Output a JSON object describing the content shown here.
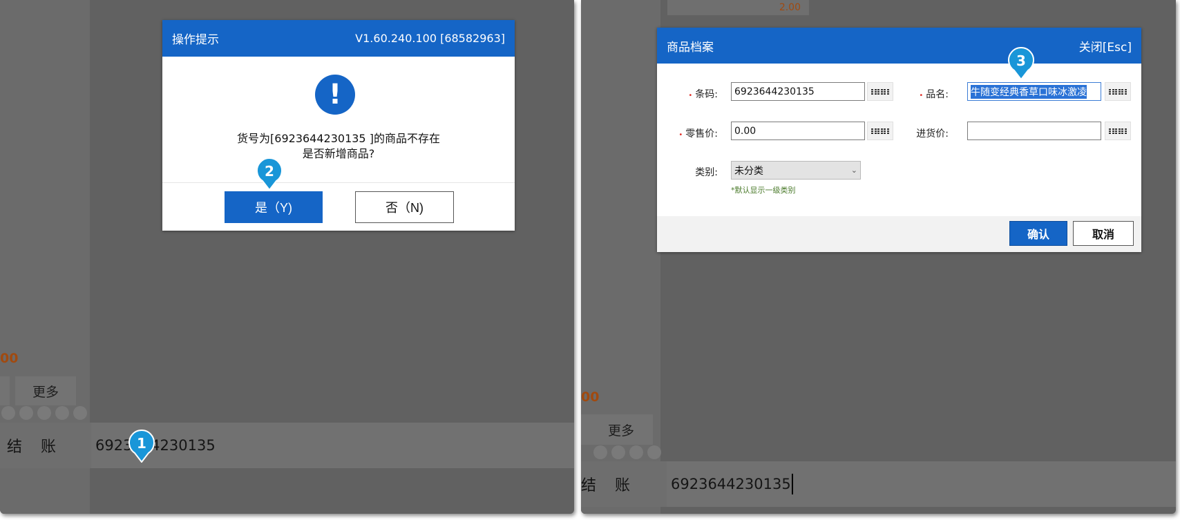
{
  "left_panel": {
    "price_fragment": "00",
    "more_button": "更多",
    "checkout_label": "结 账",
    "scan_value": "6923644230135"
  },
  "confirm_dialog": {
    "title": "操作提示",
    "version": "V1.60.240.100 [68582963]",
    "icon": "exclamation-icon",
    "message_line1": "货号为[6923644230135 ]的商品不存在",
    "message_line2": "是否新增商品?",
    "yes_button": "是（Y)",
    "no_button": "否（N)"
  },
  "right_panel": {
    "top_price": "2.00",
    "price_fragment": "00",
    "more_button": "更多",
    "checkout_label": "结 账",
    "scan_value": "6923644230135"
  },
  "product_dialog": {
    "title": "商品档案",
    "close_label": "关闭[Esc]",
    "barcode_label": "条码:",
    "barcode_value": "6923644230135",
    "name_label": "品名:",
    "name_value": "牛随变经典香草口味冰激凌",
    "retail_price_label": "零售价:",
    "retail_price_value": "0.00",
    "purchase_price_label": "进货价:",
    "purchase_price_value": "",
    "category_label": "类别:",
    "category_value": "未分类",
    "category_hint": "*默认显示一级类别",
    "confirm_button": "确认",
    "cancel_button": "取消"
  },
  "markers": [
    "1",
    "2",
    "3"
  ],
  "colors": {
    "accent": "#1565c6",
    "background": "#616161",
    "marker": "#1996d8",
    "price": "#a04a10",
    "required": "#e0302a"
  }
}
